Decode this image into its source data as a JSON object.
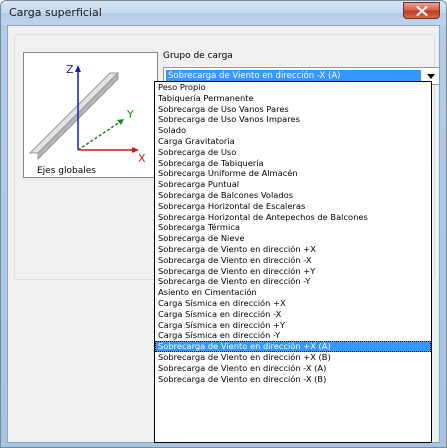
{
  "window": {
    "title": "Carga superficial"
  },
  "axes": {
    "label": "Ejes globales",
    "axis_z": "Z",
    "axis_y": "Y",
    "axis_x": "X"
  },
  "group": {
    "label": "Grupo de carga",
    "selected": "Sobrecarga de Viento en dirección -X (A)"
  },
  "options": [
    "Peso Propio",
    "Tabiquería Permanente",
    "Sobrecarga de Uso Vanos Pares",
    "Sobrecarga de Uso Vanos Impares",
    "Solado",
    "Carga Gravitatoria",
    "Sobrecarga de Uso",
    "Sobrecarga de Tabiquería",
    "Sobrecarga Uniforme de Almacén",
    "Sobrecarga Puntual",
    "Sobrecarga de Balcones Volados",
    "Sobrecarga Horizontal de Escaleras",
    "Sobrecarga Horizontal de Antepechos de Balcones",
    "Sobrecarga Térmica",
    "Sobrecarga de Nieve",
    "Sobrecarga de Viento en dirección +X",
    "Sobrecarga de Viento en dirección -X",
    "Sobrecarga de Viento en dirección +Y",
    "Sobrecarga de Viento en dirección -Y",
    "Asiento en Cimentación",
    "Carga Sísmica en dirección +X",
    "Carga Sísmica en dirección -X",
    "Carga Sísmica en dirección +Y",
    "Carga Sísmica en dirección -Y",
    "Sobrecarga de Viento en dirección +X (A)",
    "Sobrecarga de Viento en dirección +X (B)",
    "Sobrecarga de Viento en dirección -X (A)",
    "Sobrecarga de Viento en dirección -X (B)"
  ],
  "highlighted_option": "Sobrecarga de Viento en dirección +X (A)",
  "colors": {
    "axis_z": "#1a1acc",
    "axis_y": "#1a8a1a",
    "axis_x": "#cc1a1a",
    "selection": "#3399ff"
  }
}
